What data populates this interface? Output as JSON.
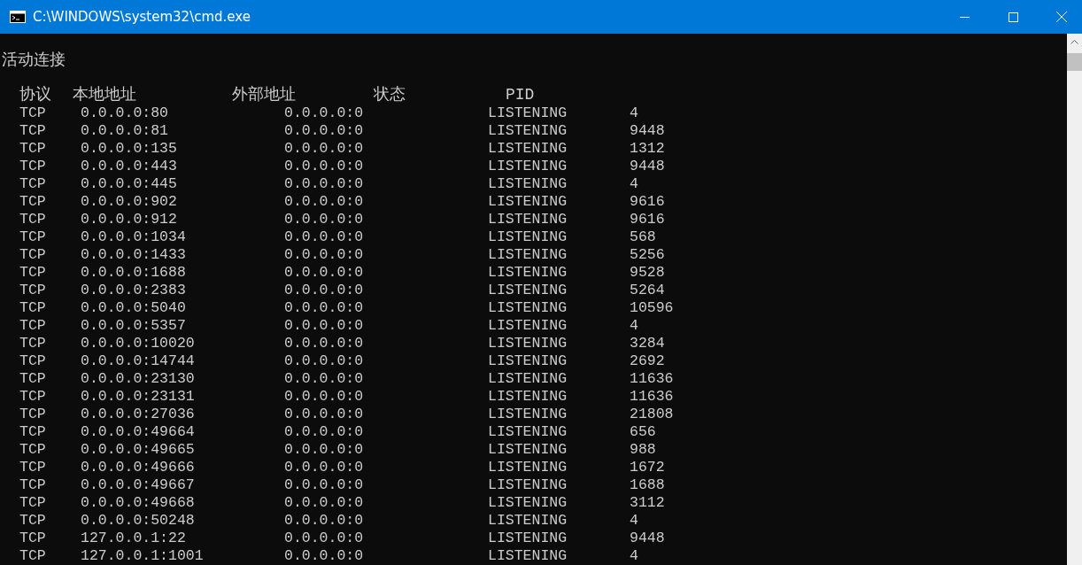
{
  "window": {
    "title": "C:\\WINDOWS\\system32\\cmd.exe"
  },
  "section_title": "活动连接",
  "columns": [
    "协议",
    "本地地址",
    "外部地址",
    "状态",
    "PID"
  ],
  "rows": [
    [
      "TCP",
      "0.0.0.0:80",
      "0.0.0.0:0",
      "LISTENING",
      "4"
    ],
    [
      "TCP",
      "0.0.0.0:81",
      "0.0.0.0:0",
      "LISTENING",
      "9448"
    ],
    [
      "TCP",
      "0.0.0.0:135",
      "0.0.0.0:0",
      "LISTENING",
      "1312"
    ],
    [
      "TCP",
      "0.0.0.0:443",
      "0.0.0.0:0",
      "LISTENING",
      "9448"
    ],
    [
      "TCP",
      "0.0.0.0:445",
      "0.0.0.0:0",
      "LISTENING",
      "4"
    ],
    [
      "TCP",
      "0.0.0.0:902",
      "0.0.0.0:0",
      "LISTENING",
      "9616"
    ],
    [
      "TCP",
      "0.0.0.0:912",
      "0.0.0.0:0",
      "LISTENING",
      "9616"
    ],
    [
      "TCP",
      "0.0.0.0:1034",
      "0.0.0.0:0",
      "LISTENING",
      "568"
    ],
    [
      "TCP",
      "0.0.0.0:1433",
      "0.0.0.0:0",
      "LISTENING",
      "5256"
    ],
    [
      "TCP",
      "0.0.0.0:1688",
      "0.0.0.0:0",
      "LISTENING",
      "9528"
    ],
    [
      "TCP",
      "0.0.0.0:2383",
      "0.0.0.0:0",
      "LISTENING",
      "5264"
    ],
    [
      "TCP",
      "0.0.0.0:5040",
      "0.0.0.0:0",
      "LISTENING",
      "10596"
    ],
    [
      "TCP",
      "0.0.0.0:5357",
      "0.0.0.0:0",
      "LISTENING",
      "4"
    ],
    [
      "TCP",
      "0.0.0.0:10020",
      "0.0.0.0:0",
      "LISTENING",
      "3284"
    ],
    [
      "TCP",
      "0.0.0.0:14744",
      "0.0.0.0:0",
      "LISTENING",
      "2692"
    ],
    [
      "TCP",
      "0.0.0.0:23130",
      "0.0.0.0:0",
      "LISTENING",
      "11636"
    ],
    [
      "TCP",
      "0.0.0.0:23131",
      "0.0.0.0:0",
      "LISTENING",
      "11636"
    ],
    [
      "TCP",
      "0.0.0.0:27036",
      "0.0.0.0:0",
      "LISTENING",
      "21808"
    ],
    [
      "TCP",
      "0.0.0.0:49664",
      "0.0.0.0:0",
      "LISTENING",
      "656"
    ],
    [
      "TCP",
      "0.0.0.0:49665",
      "0.0.0.0:0",
      "LISTENING",
      "988"
    ],
    [
      "TCP",
      "0.0.0.0:49666",
      "0.0.0.0:0",
      "LISTENING",
      "1672"
    ],
    [
      "TCP",
      "0.0.0.0:49667",
      "0.0.0.0:0",
      "LISTENING",
      "1688"
    ],
    [
      "TCP",
      "0.0.0.0:49668",
      "0.0.0.0:0",
      "LISTENING",
      "3112"
    ],
    [
      "TCP",
      "0.0.0.0:50248",
      "0.0.0.0:0",
      "LISTENING",
      "4"
    ],
    [
      "TCP",
      "127.0.0.1:22",
      "0.0.0.0:0",
      "LISTENING",
      "9448"
    ],
    [
      "TCP",
      "127.0.0.1:1001",
      "0.0.0.0:0",
      "LISTENING",
      "4"
    ]
  ]
}
